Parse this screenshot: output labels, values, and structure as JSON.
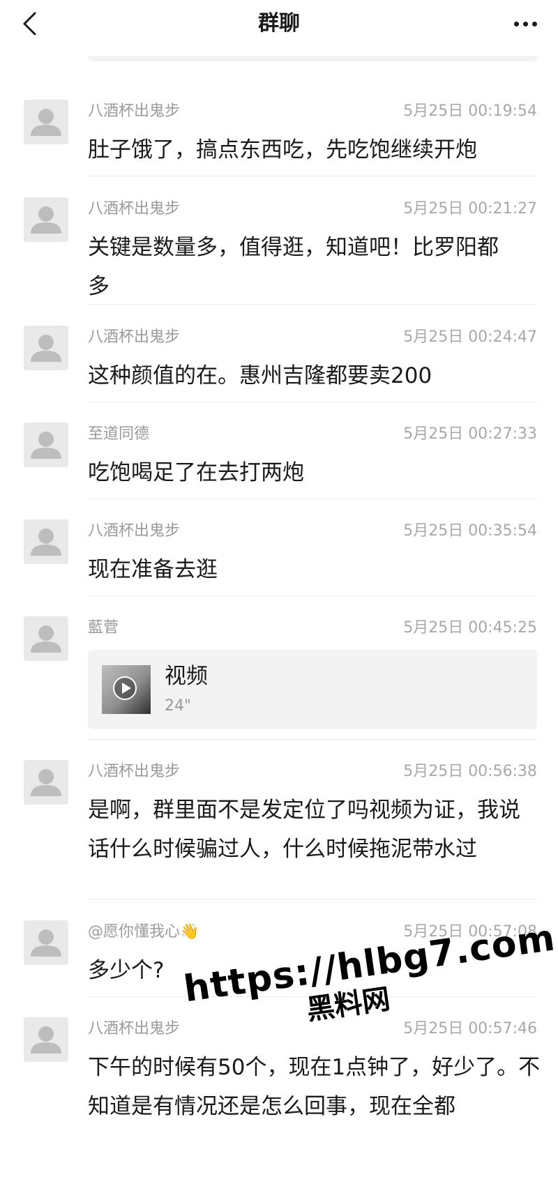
{
  "header": {
    "back_icon": "chevron-left-icon",
    "title": "群聊",
    "more_icon": "more-dots-icon"
  },
  "messages": [
    {
      "sender": "八酒杯出鬼步",
      "time": "5月25日 00:19:54",
      "text": "肚子饿了，搞点东西吃，先吃饱继续开炮"
    },
    {
      "sender": "八酒杯出鬼步",
      "time": "5月25日 00:21:27",
      "text": "关键是数量多，值得逛，知道吧！比罗阳都多"
    },
    {
      "sender": "八酒杯出鬼步",
      "time": "5月25日 00:24:47",
      "text": "这种颜值的在。惠州吉隆都要卖200"
    },
    {
      "sender": "至道同德",
      "time": "5月25日 00:27:33",
      "text": "吃饱喝足了在去打两炮"
    },
    {
      "sender": "八酒杯出鬼步",
      "time": "5月25日 00:35:54",
      "text": "现在准备去逛"
    },
    {
      "sender": "藍菅",
      "time": "5月25日 00:45:25",
      "video": {
        "label": "视频",
        "duration": "24\""
      }
    },
    {
      "sender": "八酒杯出鬼步",
      "time": "5月25日 00:56:38",
      "text": "是啊，群里面不是发定位了吗视频为证，我说话什么时候骗过人，什么时候拖泥带水过"
    },
    {
      "sender": "@愿你懂我心👋",
      "time": "5月25日 00:57:08",
      "text": "多少个?"
    },
    {
      "sender": "八酒杯出鬼步",
      "time": "5月25日 00:57:46",
      "text": "下午的时候有50个，现在1点钟了，好少了。不知道是有情况还是怎么回事，现在全都"
    }
  ],
  "watermark": {
    "url": "https://hlbg7.com",
    "name": "黑料网"
  },
  "colors": {
    "background": "#ffffff",
    "text": "#1a1a1a",
    "meta": "#9a9a9a",
    "card": "#f3f3f3"
  }
}
